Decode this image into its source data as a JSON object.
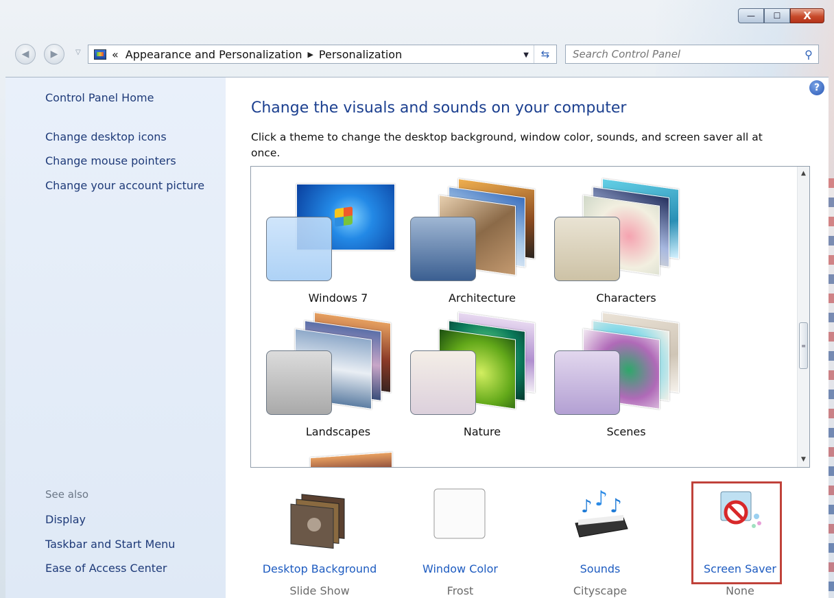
{
  "window": {
    "buttons": {
      "minimize": "—",
      "maximize": "☐",
      "close": "X"
    }
  },
  "address_bar": {
    "overflow": "«",
    "breadcrumbs": [
      "Appearance and Personalization",
      "Personalization"
    ],
    "search_placeholder": "Search Control Panel"
  },
  "sidebar": {
    "home": "Control Panel Home",
    "tasks": [
      "Change desktop icons",
      "Change mouse pointers",
      "Change your account picture"
    ],
    "see_also_heading": "See also",
    "see_also": [
      "Display",
      "Taskbar and Start Menu",
      "Ease of Access Center"
    ]
  },
  "main": {
    "title": "Change the visuals and sounds on your computer",
    "description": "Click a theme to change the desktop background, window color, sounds, and screen saver all at once.",
    "themes": [
      "Windows 7",
      "Architecture",
      "Characters",
      "Landscapes",
      "Nature",
      "Scenes"
    ],
    "settings": [
      {
        "label": "Desktop Background",
        "value": "Slide Show"
      },
      {
        "label": "Window Color",
        "value": "Frost"
      },
      {
        "label": "Sounds",
        "value": "Cityscape"
      },
      {
        "label": "Screen Saver",
        "value": "None"
      }
    ]
  },
  "colors": {
    "link": "#1d5bc0",
    "title": "#1b3f8f",
    "highlight": "#c0423a"
  }
}
